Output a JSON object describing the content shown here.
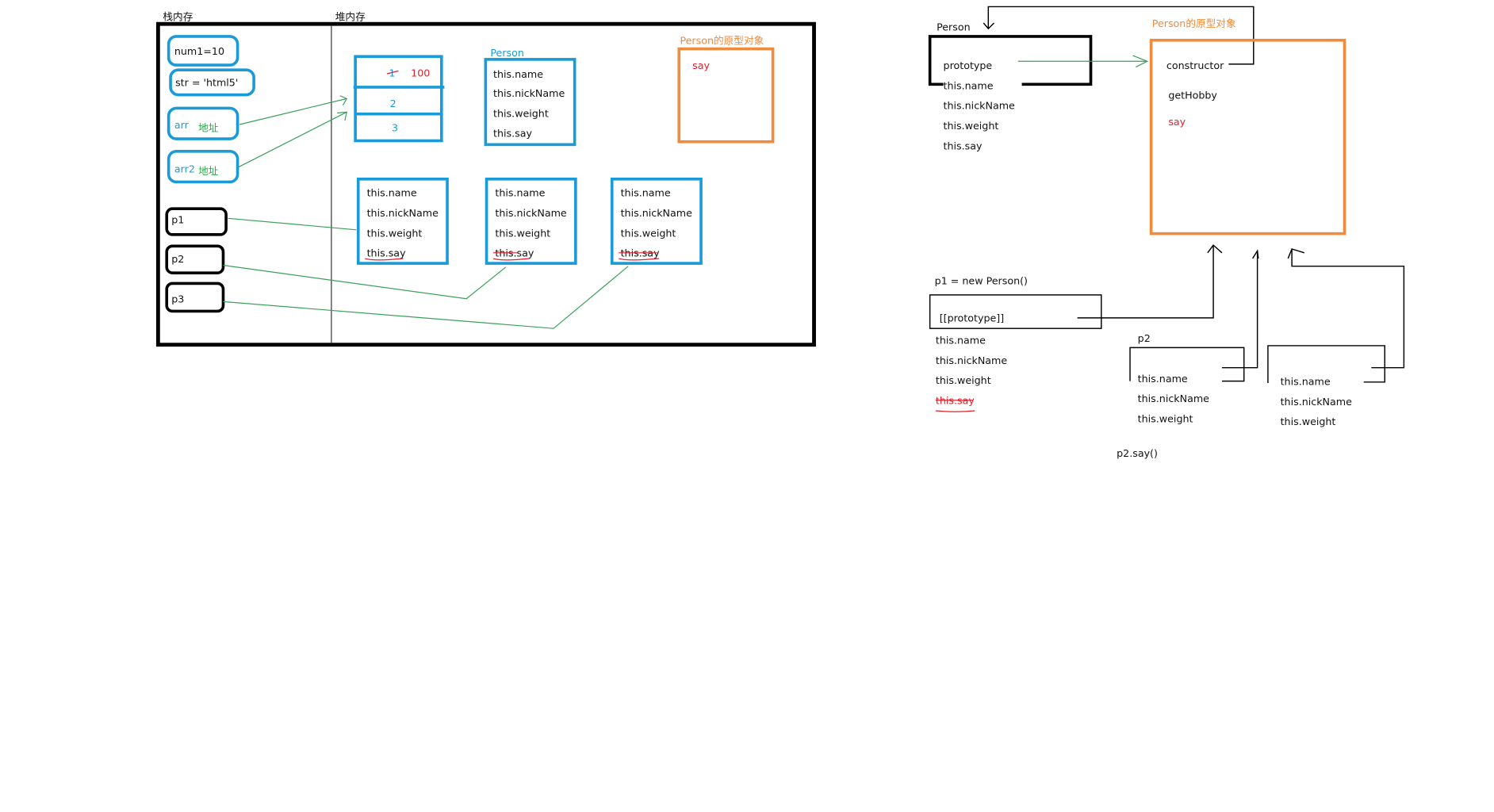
{
  "left": {
    "stack_label": "栈内存",
    "heap_label": "堆内存",
    "stack": {
      "num1": "num1=10",
      "str": "str = 'html5'",
      "arr": "arr",
      "arr2": "arr2",
      "addr": "地址",
      "p1": "p1",
      "p2": "p2",
      "p3": "p3"
    },
    "array": {
      "old": "1",
      "new": "100",
      "v2": "2",
      "v3": "3"
    },
    "person_label": "Person",
    "person_fields": [
      "this.name",
      "this.nickName",
      "this.weight",
      "this.say"
    ],
    "proto_label": "Person的原型对象",
    "proto_say": "say",
    "instances": [
      [
        "this.name",
        "this.nickName",
        "this.weight",
        "this.say"
      ],
      [
        "this.name",
        "this.nickName",
        "this.weight",
        "this.say"
      ],
      [
        "this.name",
        "this.nickName",
        "this.weight",
        "this.say"
      ]
    ]
  },
  "right": {
    "person_label": "Person",
    "person_fields": [
      "prototype",
      "this.name",
      "this.nickName",
      "this.weight",
      "this.say"
    ],
    "proto_label": "Person的原型对象",
    "proto_fields": [
      "constructor",
      "getHobby",
      "say"
    ],
    "p1_label": "p1 = new Person()",
    "p1_proto": "[[prototype]]",
    "p1_fields": [
      "this.name",
      "this.nickName",
      "this.weight",
      "this.say"
    ],
    "p2_label": "p2",
    "p2_fields": [
      "this.name",
      "this.nickName",
      "this.weight"
    ],
    "p3_fields": [
      "this.name",
      "this.nickName",
      "this.weight"
    ],
    "call": "p2.say()"
  },
  "colors": {
    "blue": "#1a9bd7",
    "green": "#2fa84f",
    "red": "#e0202c",
    "orange": "#f08a3c"
  }
}
